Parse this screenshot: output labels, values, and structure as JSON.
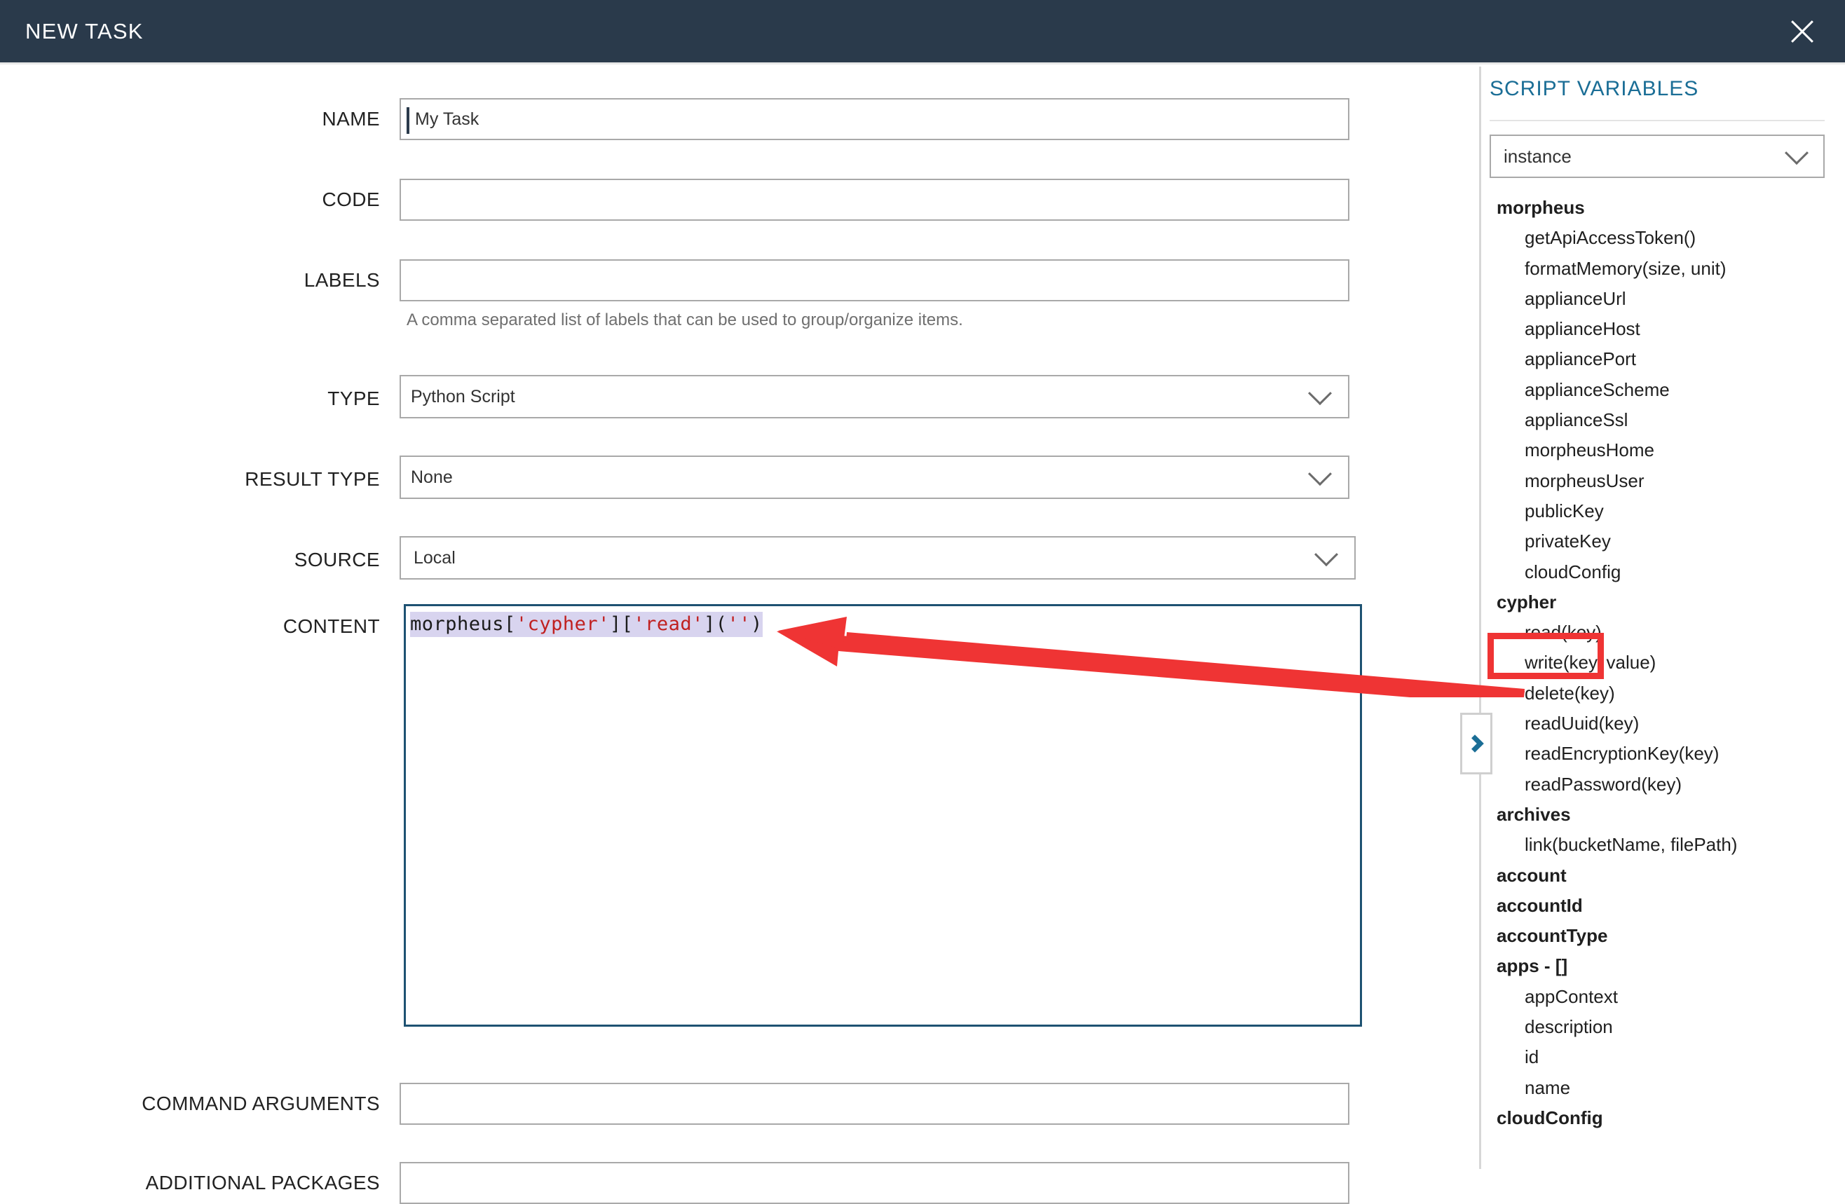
{
  "header": {
    "title": "NEW TASK",
    "close_icon": "close-icon"
  },
  "form": {
    "fields": [
      {
        "label": "NAME",
        "value": "My Task",
        "has_caret": true
      },
      {
        "label": "CODE",
        "value": "",
        "has_caret": false
      },
      {
        "label": "LABELS",
        "value": "",
        "has_caret": false
      }
    ],
    "labels_hint": "A comma separated list of labels that can be used to group/organize items.",
    "selects": [
      {
        "label": "TYPE",
        "value": "Python Script",
        "has_caret": false
      },
      {
        "label": "RESULT TYPE",
        "value": "None",
        "has_caret": false
      },
      {
        "label": "SOURCE",
        "value": "Local",
        "has_caret": true
      }
    ],
    "content": {
      "label": "CONTENT",
      "code_tokens": [
        {
          "t": "morpheus",
          "k": "plain"
        },
        {
          "t": "[",
          "k": "plain"
        },
        {
          "t": "'cypher'",
          "k": "str"
        },
        {
          "t": "]",
          "k": "plain"
        },
        {
          "t": "[",
          "k": "plain"
        },
        {
          "t": "'read'",
          "k": "str"
        },
        {
          "t": "]",
          "k": "plain"
        },
        {
          "t": "(",
          "k": "plain"
        },
        {
          "t": "''",
          "k": "str"
        },
        {
          "t": ")",
          "k": "plain"
        }
      ],
      "code_text": "morpheus['cypher']['read']('')"
    },
    "command_arguments": {
      "label": "COMMAND ARGUMENTS",
      "value": ""
    },
    "additional_packages": {
      "label": "ADDITIONAL PACKAGES",
      "value": ""
    }
  },
  "sidebar": {
    "title": "SCRIPT VARIABLES",
    "context_select": {
      "value": "instance",
      "icon": "chevron-down-icon"
    },
    "collapse_handle_icon": "chevron-right-icon",
    "variables": [
      {
        "name": "morpheus",
        "level": "group"
      },
      {
        "name": "getApiAccessToken()",
        "level": "child"
      },
      {
        "name": "formatMemory(size, unit)",
        "level": "child"
      },
      {
        "name": "applianceUrl",
        "level": "child"
      },
      {
        "name": "applianceHost",
        "level": "child"
      },
      {
        "name": "appliancePort",
        "level": "child"
      },
      {
        "name": "applianceScheme",
        "level": "child"
      },
      {
        "name": "applianceSsl",
        "level": "child"
      },
      {
        "name": "morpheusHome",
        "level": "child"
      },
      {
        "name": "morpheusUser",
        "level": "child"
      },
      {
        "name": "publicKey",
        "level": "child"
      },
      {
        "name": "privateKey",
        "level": "child"
      },
      {
        "name": "cloudConfig",
        "level": "child"
      },
      {
        "name": "cypher",
        "level": "group"
      },
      {
        "name": "read(key)",
        "level": "child"
      },
      {
        "name": "write(key, value)",
        "level": "child"
      },
      {
        "name": "delete(key)",
        "level": "child"
      },
      {
        "name": "readUuid(key)",
        "level": "child"
      },
      {
        "name": "readEncryptionKey(key)",
        "level": "child"
      },
      {
        "name": "readPassword(key)",
        "level": "child"
      },
      {
        "name": "archives",
        "level": "group"
      },
      {
        "name": "link(bucketName, filePath)",
        "level": "child"
      },
      {
        "name": "account",
        "level": "group"
      },
      {
        "name": "accountId",
        "level": "group"
      },
      {
        "name": "accountType",
        "level": "group"
      },
      {
        "name": "apps - []",
        "level": "group"
      },
      {
        "name": "appContext",
        "level": "child"
      },
      {
        "name": "description",
        "level": "child"
      },
      {
        "name": "id",
        "level": "child"
      },
      {
        "name": "name",
        "level": "child"
      },
      {
        "name": "cloudConfig",
        "level": "group"
      }
    ]
  },
  "annotations": {
    "highlight_color": "#ef3434",
    "highlight_target": "read(key)",
    "arrow_from": "read(key)",
    "arrow_to": "morpheus['cypher']['read']('')"
  }
}
